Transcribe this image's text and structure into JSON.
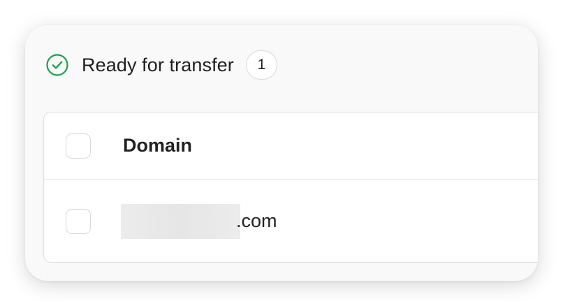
{
  "section": {
    "title": "Ready for transfer",
    "count": "1",
    "status_color": "#1aa04a",
    "icon": "check-circle-icon"
  },
  "table": {
    "columns": [
      "Domain"
    ],
    "rows": [
      {
        "domain_suffix": ".com",
        "domain_redacted": true
      }
    ]
  }
}
